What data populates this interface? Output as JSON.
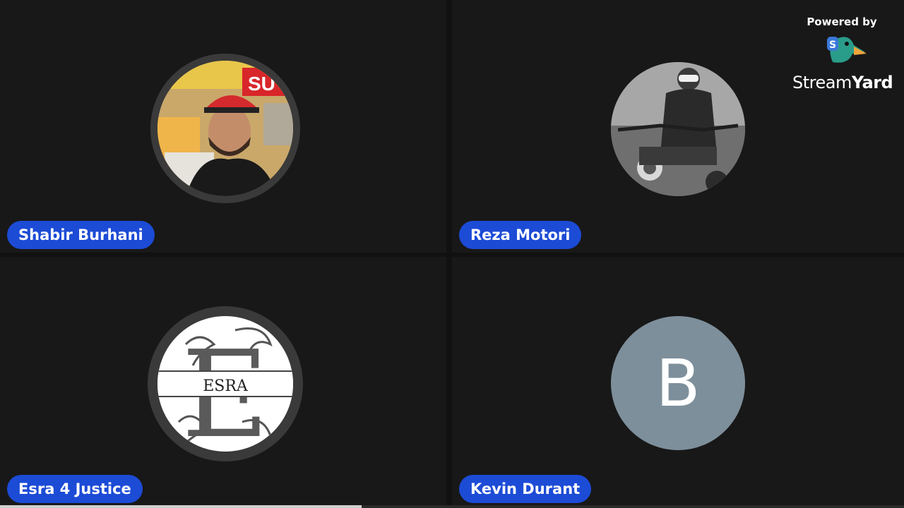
{
  "branding": {
    "powered_by": "Powered by",
    "logo_word_1": "Stream",
    "logo_word_2": "Yard",
    "logo_icon": "duck-logo-icon"
  },
  "participants": [
    {
      "name": "Shabir Burhani",
      "avatar": "photo"
    },
    {
      "name": "Reza Motori",
      "avatar": "photo-bw-motorcycle"
    },
    {
      "name": "Esra 4 Justice",
      "avatar": "monogram-logo",
      "monogram_letter": "E",
      "monogram_text": "ESRA"
    },
    {
      "name": "Kevin Durant",
      "avatar": "initial",
      "initial": "B",
      "avatar_color": "#7d8f9b"
    }
  ],
  "colors": {
    "background": "#111111",
    "tile": "#181818",
    "badge": "#1c4bd6"
  },
  "progress": {
    "fraction": 0.4
  }
}
